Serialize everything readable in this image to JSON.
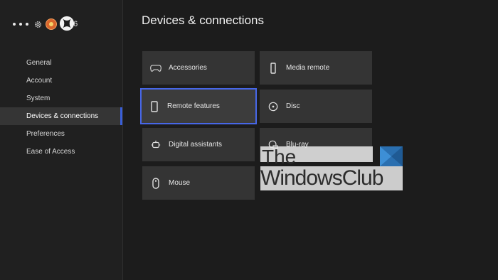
{
  "header": {
    "gamertag": "C...6",
    "icons": [
      "more-dots-icon",
      "gear-icon",
      "avatar",
      "xbox-logo-icon"
    ]
  },
  "sidebar": {
    "items": [
      {
        "label": "General",
        "active": false
      },
      {
        "label": "Account",
        "active": false
      },
      {
        "label": "System",
        "active": false
      },
      {
        "label": "Devices & connections",
        "active": true
      },
      {
        "label": "Preferences",
        "active": false
      },
      {
        "label": "Ease of Access",
        "active": false
      }
    ]
  },
  "main": {
    "title": "Devices & connections",
    "tiles": [
      {
        "label": "Accessories",
        "icon": "gamepad-icon"
      },
      {
        "label": "Media remote",
        "icon": "remote-icon"
      },
      {
        "label": "Remote features",
        "icon": "phone-icon",
        "selected": true
      },
      {
        "label": "Disc",
        "icon": "disc-icon"
      },
      {
        "label": "Digital assistants",
        "icon": "assistant-icon"
      },
      {
        "label": "Blu-ray",
        "icon": "bluray-icon"
      },
      {
        "label": "Mouse",
        "icon": "mouse-icon"
      }
    ]
  },
  "watermark": {
    "line1": "The",
    "line2": "WindowsClub"
  },
  "colors": {
    "accent": "#4767e8",
    "background": "#1c1c1c",
    "tile": "#343434"
  }
}
